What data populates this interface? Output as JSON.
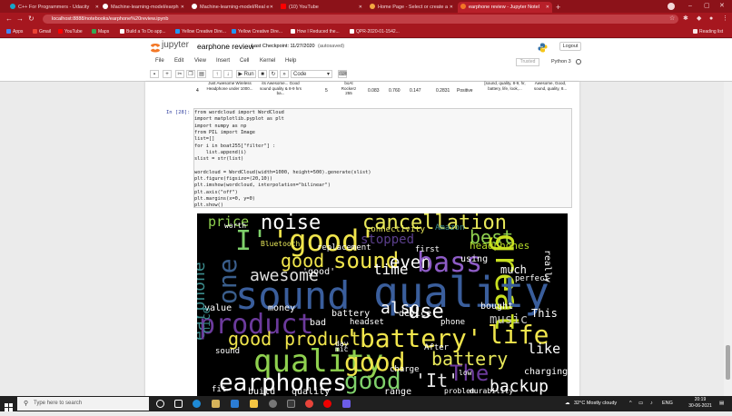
{
  "browser": {
    "tabs": [
      {
        "label": "C++ For Programmers - Udacity",
        "color": "#16a5c9"
      },
      {
        "label": "Machine-learning-model/earph",
        "color": "#ffffff"
      },
      {
        "label": "Machine-learning-model/Real e",
        "color": "#ffffff"
      },
      {
        "label": "(10) YouTube",
        "color": "#ff0000"
      },
      {
        "label": "Home Page - Select or create a",
        "color": "#f3a742"
      },
      {
        "label": "earphone review - Jupyter Notel",
        "color": "#f37626"
      }
    ],
    "new_tab": "+",
    "url": "localhost:8888/notebooks/earphone%20review.ipynb",
    "bookmarks": [
      {
        "label": "Apps",
        "color": "#4285f4"
      },
      {
        "label": "Gmail",
        "color": "#ea4335"
      },
      {
        "label": "YouTube",
        "color": "#ff0000"
      },
      {
        "label": "Maps",
        "color": "#34a853"
      },
      {
        "label": "Build a To Do app...",
        "color": "#ffffff"
      },
      {
        "label": "Yellow Creative Dire...",
        "color": "#2196f3"
      },
      {
        "label": "Yellow Creative Dire...",
        "color": "#2196f3"
      },
      {
        "label": "How I Reduced the...",
        "color": "#ffffff"
      },
      {
        "label": "QPR-2020-01-1542...",
        "color": "#ffffff"
      }
    ],
    "reading_list": "Reading list"
  },
  "jupyter": {
    "logo": "jupyter",
    "notebook_name": "earphone review",
    "checkpoint": "Last Checkpoint: 11/27/2020",
    "autosaved": "(autosaved)",
    "logout": "Logout",
    "menus": [
      "File",
      "Edit",
      "View",
      "Insert",
      "Cell",
      "Kernel",
      "Help"
    ],
    "trusted": "Trusted",
    "kernel": "Python 3",
    "run_label": "Run",
    "cell_type": "Code"
  },
  "table_row": {
    "index": "4",
    "review": "Just Awesome Wireless Headphone under 1000...",
    "summary": "its Awesome... Good sound quality & 8-9 hrs ba...",
    "rating": "5",
    "product": "boAt Rockerz 255",
    "v1": "0.083",
    "v2": "0.760",
    "v3": "0.147",
    "v4": "0.2831",
    "sentiment": "Positive",
    "tokens": "[sound, quality, 8-9, hr, battery, life, look,...",
    "filter": "Awesome, Good, sound, quality, 8..."
  },
  "cell": {
    "prompt": "In [28]:",
    "lines": [
      "from wordcloud import WordCloud",
      "import matplotlib.pyplot as plt",
      "import numpy as np",
      "from PIL import Image",
      "list=[]",
      "for i in boat255[\"filter\"] :",
      "    list.append(i)",
      "slist = str(list)",
      "",
      "wordcloud = WordCloud(width=1000, height=500).generate(slist)",
      "plt.figure(figsize=(20,10))",
      "plt.imshow(wordcloud, interpolation=\"bilinear\")",
      "plt.axis(\"off\")",
      "plt.margins(x=0, y=0)",
      "plt.show()"
    ]
  },
  "wordcloud": [
    {
      "t": "price",
      "c": "#8fd14f"
    },
    {
      "t": "noise",
      "c": "#ffffff"
    },
    {
      "t": "cancellation",
      "c": "#e8e85a"
    },
    {
      "t": "'good'",
      "c": "#f0e54c"
    },
    {
      "t": "I'",
      "c": "#7fd16b"
    },
    {
      "t": "best",
      "c": "#8fd14f"
    },
    {
      "t": "stopped",
      "c": "#5b3f8c"
    },
    {
      "t": "connectivity",
      "c": "#e8e85a"
    },
    {
      "t": "Amazon",
      "c": "#3b8b8c"
    },
    {
      "t": "headphones",
      "c": "#b8de29"
    },
    {
      "t": "earphone",
      "c": "#3b8b8c"
    },
    {
      "t": "one",
      "c": "#3a5e8c"
    },
    {
      "t": "good",
      "c": "#f0e54c"
    },
    {
      "t": "sound",
      "c": "#f0e54c"
    },
    {
      "t": "even",
      "c": "#ffffff"
    },
    {
      "t": "bass",
      "c": "#8e5cc6"
    },
    {
      "t": "great",
      "c": "#c8e020"
    },
    {
      "t": "awesome",
      "c": "#e0e0e0"
    },
    {
      "t": "sound",
      "c": "#3a5e9c"
    },
    {
      "t": "quality",
      "c": "#3a5e9c"
    },
    {
      "t": "product",
      "c": "#6c3a9c"
    },
    {
      "t": "use",
      "c": "#ffffff"
    },
    {
      "t": "music",
      "c": "#c0c0c0"
    },
    {
      "t": "good",
      "c": "#f0e54c"
    },
    {
      "t": "product",
      "c": "#f0e54c"
    },
    {
      "t": "'battery'",
      "c": "#f0e54c"
    },
    {
      "t": "life",
      "c": "#f0e54c"
    },
    {
      "t": "quality",
      "c": "#8fd14f"
    },
    {
      "t": "good",
      "c": "#f0e54c"
    },
    {
      "t": "battery",
      "c": "#e8e85a"
    },
    {
      "t": "like",
      "c": "#ffffff"
    },
    {
      "t": "earphones",
      "c": "#ffffff"
    },
    {
      "t": "good",
      "c": "#7fd16b"
    },
    {
      "t": "'It'",
      "c": "#e0e0e0"
    },
    {
      "t": "backup",
      "c": "#ffffff"
    },
    {
      "t": "The",
      "c": "#6c3a9c"
    },
    {
      "t": "value",
      "c": "#ffffff"
    },
    {
      "t": "money",
      "c": "#ffffff"
    },
    {
      "t": "Bluetooth",
      "c": "#e8e85a"
    },
    {
      "t": "replacement",
      "c": "#ffffff"
    },
    {
      "t": "time",
      "c": "#ffffff"
    },
    {
      "t": "also",
      "c": "#ffffff"
    },
    {
      "t": "'good'",
      "c": "#ffffff"
    },
    {
      "t": "battery",
      "c": "#ffffff"
    },
    {
      "t": "bad",
      "c": "#ffffff"
    },
    {
      "t": "headset",
      "c": "#ffffff"
    },
    {
      "t": "charge",
      "c": "#ffffff"
    },
    {
      "t": "problem",
      "c": "#ffffff"
    },
    {
      "t": "range",
      "c": "#ffffff"
    },
    {
      "t": "durability",
      "c": "#ffffff"
    },
    {
      "t": "charging",
      "c": "#ffffff"
    },
    {
      "t": "nice",
      "c": "#3b8b8c"
    },
    {
      "t": "This",
      "c": "#ffffff"
    },
    {
      "t": "much",
      "c": "#ffffff"
    },
    {
      "t": "really",
      "c": "#ffffff"
    },
    {
      "t": "perfect",
      "c": "#ffffff"
    },
    {
      "t": "phone",
      "c": "#ffffff"
    },
    {
      "t": "device",
      "c": "#ffffff"
    },
    {
      "t": "using",
      "c": "#ffffff"
    },
    {
      "t": "bought",
      "c": "#ffffff"
    },
    {
      "t": "After",
      "c": "#ffffff"
    },
    {
      "t": "sound",
      "c": "#ffffff"
    },
    {
      "t": "worth",
      "c": "#ffffff"
    },
    {
      "t": "fit",
      "c": "#ffffff"
    },
    {
      "t": "build",
      "c": "#ffffff"
    },
    {
      "t": "quality",
      "c": "#ffffff"
    },
    {
      "t": "day",
      "c": "#ffffff"
    },
    {
      "t": "low",
      "c": "#ffffff"
    },
    {
      "t": "mic",
      "c": "#ffffff"
    },
    {
      "t": "first",
      "c": "#ffffff"
    }
  ],
  "taskbar": {
    "search_placeholder": "Type here to search",
    "weather": "32°C  Mostly cloudy",
    "lang": "ENG",
    "time": "20:19",
    "date": "30-06-2021"
  }
}
